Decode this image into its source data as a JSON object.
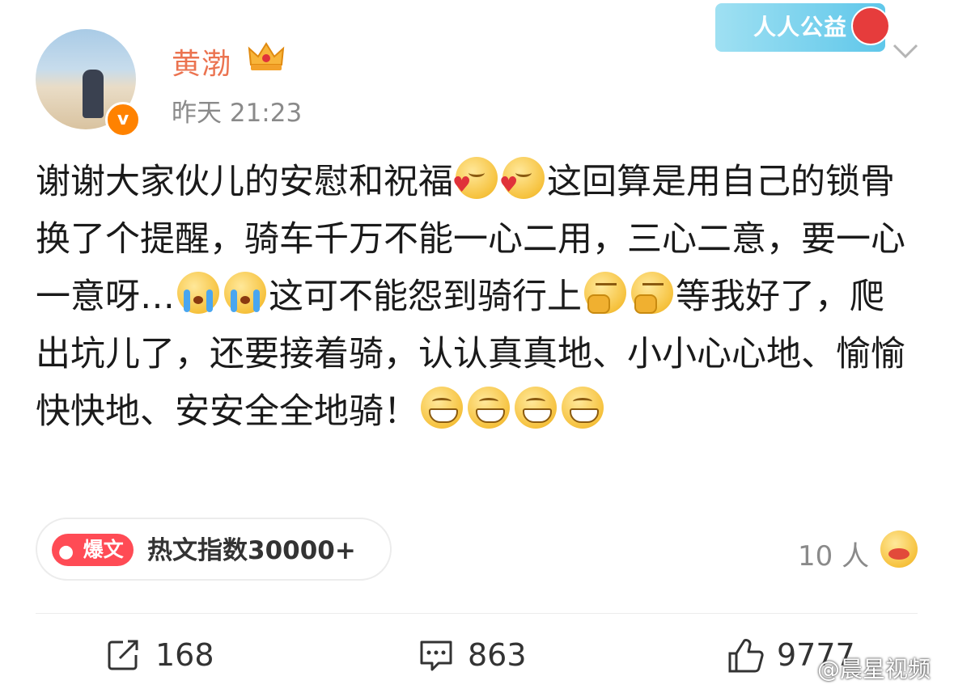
{
  "header": {
    "username": "黄渤",
    "timestamp": "昨天 21:23",
    "promo_label": "人人公益",
    "verified_mark": "v"
  },
  "post": {
    "segments": [
      {
        "type": "text",
        "value": "谢谢大家伙儿的安慰和祝福"
      },
      {
        "type": "emoji",
        "name": "shy"
      },
      {
        "type": "emoji",
        "name": "shy"
      },
      {
        "type": "text",
        "value": "这回算是用自己的锁骨换了个提醒，骑车千万不能一心二用，三心二意，要一心一意呀…"
      },
      {
        "type": "emoji",
        "name": "cry"
      },
      {
        "type": "emoji",
        "name": "cry"
      },
      {
        "type": "text",
        "value": "这可不能怨到骑行上"
      },
      {
        "type": "emoji",
        "name": "think"
      },
      {
        "type": "emoji",
        "name": "think"
      },
      {
        "type": "text",
        "value": "等我好了，爬出坑儿了，还要接着骑，认认真真地、小小心心地、愉愉快快地、安安全全地骑！"
      },
      {
        "type": "emoji",
        "name": "grin"
      },
      {
        "type": "emoji",
        "name": "grin"
      },
      {
        "type": "emoji",
        "name": "grin"
      },
      {
        "type": "emoji",
        "name": "grin"
      }
    ]
  },
  "hot": {
    "badge_label": "爆文",
    "index_text": "热文指数30000+"
  },
  "reactions": {
    "count_text": "10 人",
    "emoji": "blush-icon"
  },
  "actions": {
    "repost_count": "168",
    "comment_count": "863",
    "like_count": "9777"
  },
  "watermark": "@晨星视频",
  "colors": {
    "username": "#eb7350",
    "verified": "#ff8200",
    "hot_badge": "#ff4b55"
  }
}
